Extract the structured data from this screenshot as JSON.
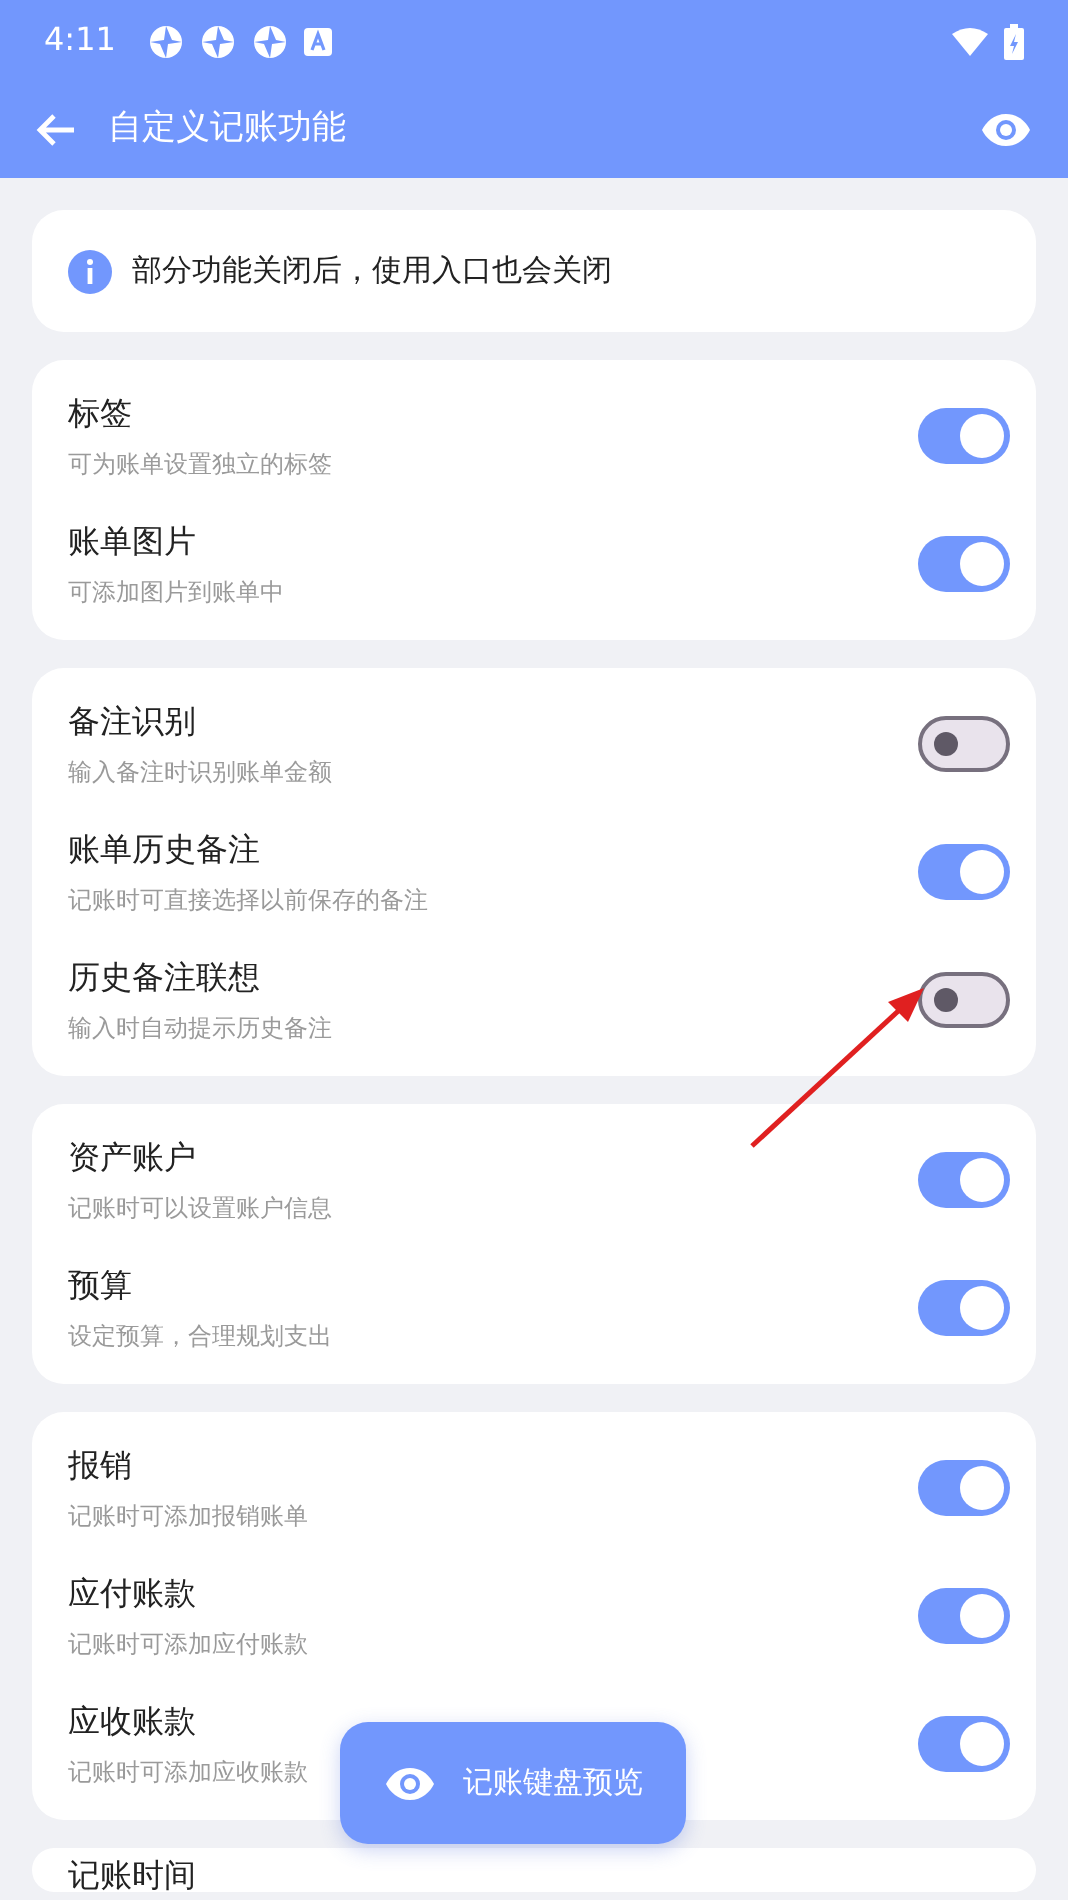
{
  "status_bar": {
    "time": "4:11"
  },
  "app_bar": {
    "title": "自定义记账功能"
  },
  "notice": {
    "text": "部分功能关闭后，使用入口也会关闭"
  },
  "groups": [
    {
      "items": [
        {
          "title": "标签",
          "subtitle": "可为账单设置独立的标签",
          "on": true
        },
        {
          "title": "账单图片",
          "subtitle": "可添加图片到账单中",
          "on": true
        }
      ]
    },
    {
      "items": [
        {
          "title": "备注识别",
          "subtitle": "输入备注时识别账单金额",
          "on": false
        },
        {
          "title": "账单历史备注",
          "subtitle": "记账时可直接选择以前保存的备注",
          "on": true
        },
        {
          "title": "历史备注联想",
          "subtitle": "输入时自动提示历史备注",
          "on": false
        }
      ]
    },
    {
      "items": [
        {
          "title": "资产账户",
          "subtitle": "记账时可以设置账户信息",
          "on": true
        },
        {
          "title": "预算",
          "subtitle": "设定预算，合理规划支出",
          "on": true
        }
      ]
    },
    {
      "items": [
        {
          "title": "报销",
          "subtitle": "记账时可添加报销账单",
          "on": true
        },
        {
          "title": "应付账款",
          "subtitle": "记账时可添加应付账款",
          "on": true
        },
        {
          "title": "应收账款",
          "subtitle": "记账时可添加应收账款",
          "on": true
        }
      ]
    },
    {
      "items": [
        {
          "title": "记账时间"
        }
      ]
    }
  ],
  "fab": {
    "label": "记账键盘预览"
  }
}
